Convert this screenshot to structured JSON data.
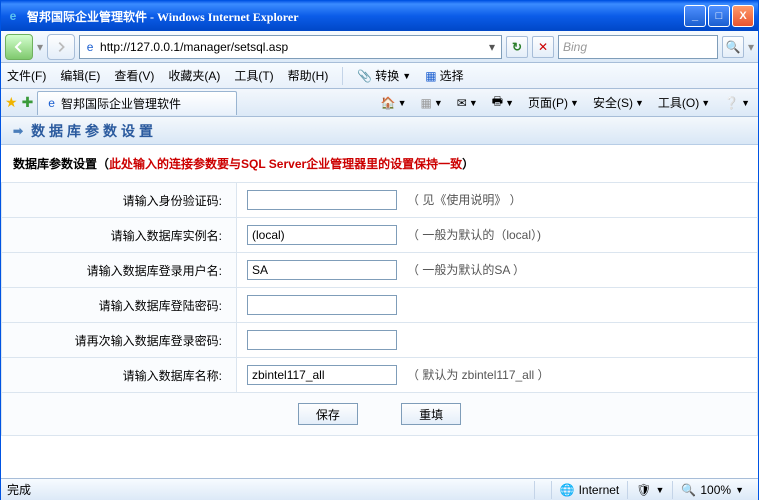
{
  "window": {
    "title": "智邦国际企业管理软件 - Windows Internet Explorer",
    "buttons": {
      "min": "_",
      "max": "□",
      "close": "X"
    }
  },
  "nav": {
    "url": "http://127.0.0.1/manager/setsql.asp",
    "search_placeholder": "Bing"
  },
  "menu": {
    "file": "文件(F)",
    "edit": "编辑(E)",
    "view": "查看(V)",
    "fav": "收藏夹(A)",
    "tools": "工具(T)",
    "help": "帮助(H)",
    "convert": "转换",
    "select": "选择"
  },
  "tab": {
    "label": "智邦国际企业管理软件"
  },
  "toolbar": {
    "page": "页面(P)",
    "safety": "安全(S)",
    "tools": "工具(O)"
  },
  "section": {
    "title": "数据库参数设置"
  },
  "warn": {
    "prefix": "数据库参数设置（",
    "red": "此处输入的连接参数要与SQL Server企业管理器里的设置保持一致",
    "suffix": "）"
  },
  "form": {
    "labels": {
      "auth": "请输入身份验证码",
      "instance": "请输入数据库实例名",
      "user": "请输入数据库登录用户名",
      "pwd": "请输入数据库登陆密码",
      "pwd2": "请再次输入数据库登录密码",
      "dbname": "请输入数据库名称"
    },
    "values": {
      "auth": "",
      "instance": "(local)",
      "user": "SA",
      "pwd": "",
      "pwd2": "",
      "dbname": "zbintel117_all"
    },
    "hints": {
      "auth": "（ 见《使用说明》 ）",
      "instance": "（ 一般为默认的（local）)",
      "user": "（ 一般为默认的SA ）",
      "dbname": "（ 默认为 zbintel117_all ）"
    },
    "buttons": {
      "save": "保存",
      "reset": "重填"
    }
  },
  "status": {
    "done": "完成",
    "zone": "Internet",
    "zoom": "100%"
  }
}
